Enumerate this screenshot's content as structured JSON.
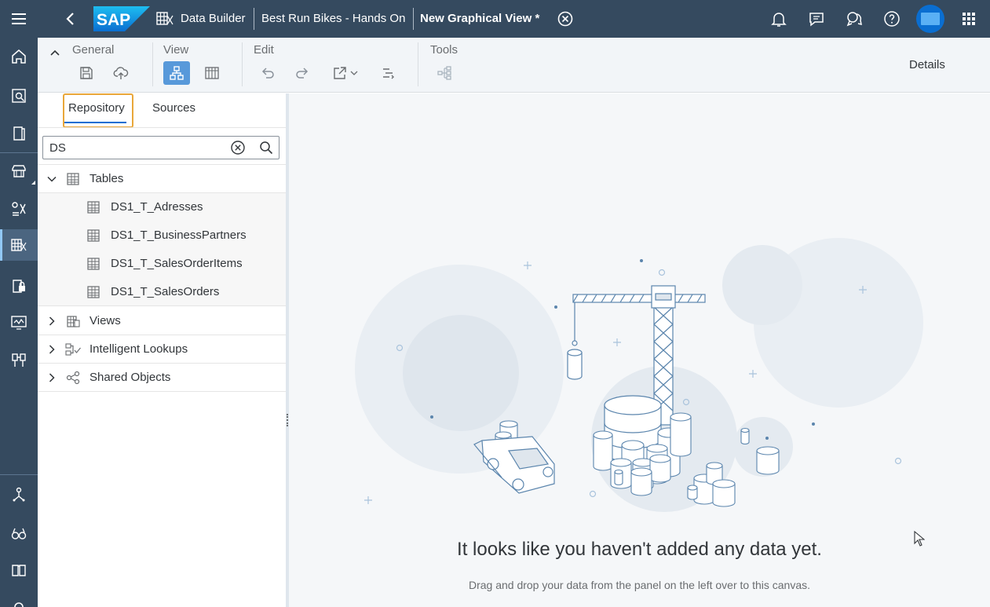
{
  "shell": {
    "logo": "SAP",
    "breadcrumbs": [
      "Data Builder",
      "Best Run Bikes - Hands On",
      "New Graphical View *"
    ],
    "icons": [
      "menu-icon",
      "back-icon",
      "bell-icon",
      "feedback-icon",
      "chat-icon",
      "help-icon",
      "avatar",
      "apps-grid-icon"
    ],
    "colors": {
      "shell": "#354a5f",
      "accent": "#0a6ed1"
    }
  },
  "toolbar": {
    "groups": {
      "general": "General",
      "view": "View",
      "edit": "Edit",
      "tools": "Tools"
    },
    "details": "Details"
  },
  "panel": {
    "tabs": {
      "repository": "Repository",
      "sources": "Sources"
    },
    "search": {
      "value": "DS",
      "placeholder": "Search"
    },
    "tree": {
      "tables": {
        "label": "Tables",
        "items": [
          "DS1_T_Adresses",
          "DS1_T_BusinessPartners",
          "DS1_T_SalesOrderItems",
          "DS1_T_SalesOrders"
        ]
      },
      "views": "Views",
      "lookups": "Intelligent Lookups",
      "shared": "Shared Objects"
    }
  },
  "canvas": {
    "title": "It looks like you haven't added any data yet.",
    "subtitle": "Drag and drop your data from the panel on the left over to this canvas."
  }
}
